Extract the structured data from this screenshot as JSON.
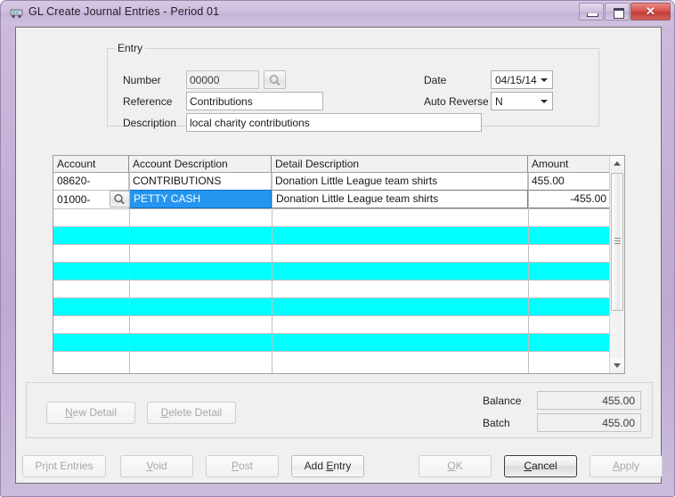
{
  "window": {
    "title": "GL Create Journal Entries - Period 01",
    "icon": "app-window-icon",
    "controls": {
      "minimize": "minimize-icon",
      "maximize": "maximize-icon",
      "close": "✕"
    },
    "frame_color": "#c3b0d6",
    "client_color": "#f0f0f0"
  },
  "entry": {
    "legend": "Entry",
    "number_label": "Number",
    "number_value": "00000",
    "number_lookup_icon": "magnifier-icon",
    "reference_label": "Reference",
    "reference_value": "Contributions",
    "description_label": "Description",
    "description_value": "local charity contributions",
    "date_label": "Date",
    "date_value": "04/15/14",
    "auto_reverse_label": "Auto Reverse",
    "auto_reverse_value": "N"
  },
  "grid": {
    "columns": [
      {
        "key": "account",
        "label": "Account"
      },
      {
        "key": "account_description",
        "label": "Account Description"
      },
      {
        "key": "detail_description",
        "label": "Detail Description"
      },
      {
        "key": "amount",
        "label": "Amount"
      }
    ],
    "rows": [
      {
        "account": "08620-",
        "account_description": "CONTRIBUTIONS",
        "detail_description": "Donation Little League team shirts",
        "amount": "455.00",
        "state": "normal"
      },
      {
        "account": "01000-",
        "account_description": "PETTY CASH",
        "detail_description": "Donation Little League team shirts",
        "amount": "-455.00",
        "state": "editing",
        "selected_cell": "account_description",
        "lookup_icon": "magnifier-icon"
      },
      {
        "account": "",
        "account_description": "",
        "detail_description": "",
        "amount": "",
        "state": "empty"
      },
      {
        "account": "",
        "account_description": "",
        "detail_description": "",
        "amount": "",
        "state": "highlight"
      },
      {
        "account": "",
        "account_description": "",
        "detail_description": "",
        "amount": "",
        "state": "empty"
      },
      {
        "account": "",
        "account_description": "",
        "detail_description": "",
        "amount": "",
        "state": "highlight"
      },
      {
        "account": "",
        "account_description": "",
        "detail_description": "",
        "amount": "",
        "state": "empty"
      },
      {
        "account": "",
        "account_description": "",
        "detail_description": "",
        "amount": "",
        "state": "highlight"
      },
      {
        "account": "",
        "account_description": "",
        "detail_description": "",
        "amount": "",
        "state": "empty"
      },
      {
        "account": "",
        "account_description": "",
        "detail_description": "",
        "amount": "",
        "state": "highlight"
      },
      {
        "account": "",
        "account_description": "",
        "detail_description": "",
        "amount": "",
        "state": "empty"
      }
    ],
    "selection_color": "#2596f0",
    "highlight_color": "#00ffff",
    "scrollbar": {
      "up_arrow": "scroll-up-icon",
      "down_arrow": "scroll-down-icon",
      "thumb": "scroll-thumb"
    }
  },
  "detail": {
    "new_detail": {
      "label": "New Detail",
      "accel": "N",
      "enabled": false
    },
    "delete_detail": {
      "label": "Delete Detail",
      "accel": "D",
      "enabled": false
    },
    "balance_label": "Balance",
    "balance_value": "455.00",
    "batch_label": "Batch",
    "batch_value": "455.00"
  },
  "actions": {
    "print_entries": {
      "label": "Print Entries",
      "enabled": false
    },
    "void": {
      "label": "Void",
      "enabled": false
    },
    "post": {
      "label": "Post",
      "enabled": false
    },
    "add_entry": {
      "label": "Add Entry",
      "enabled": true
    },
    "ok": {
      "label": "OK",
      "enabled": false
    },
    "cancel": {
      "label": "Cancel",
      "enabled": true,
      "default": true
    },
    "apply": {
      "label": "Apply",
      "enabled": false
    }
  }
}
